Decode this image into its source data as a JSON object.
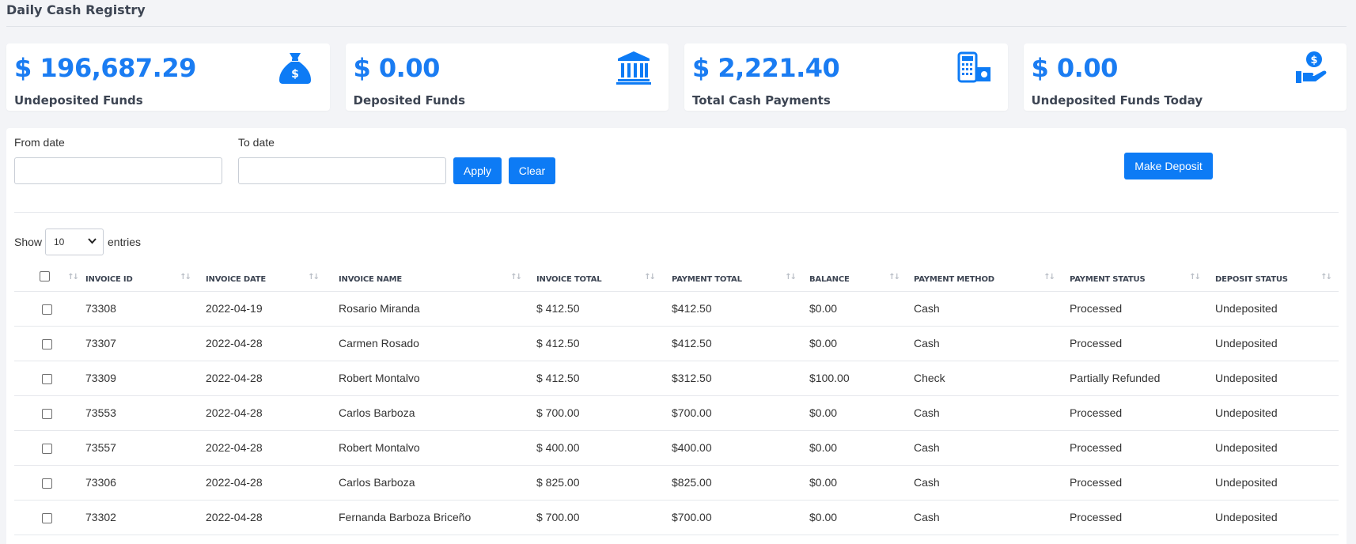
{
  "page": {
    "title": "Daily Cash Registry"
  },
  "colors": {
    "accent": "#1a7cf2",
    "button": "#0d7bf5"
  },
  "cards": [
    {
      "amount": "$ 196,687.29",
      "label": "Undeposited Funds",
      "icon": "money-bag-icon"
    },
    {
      "amount": "$ 0.00",
      "label": "Deposited Funds",
      "icon": "bank-icon"
    },
    {
      "amount": "$ 2,221.40",
      "label": "Total Cash Payments",
      "icon": "calculator-cash-icon"
    },
    {
      "amount": "$ 0.00",
      "label": "Undeposited Funds Today",
      "icon": "hand-coin-icon"
    }
  ],
  "filters": {
    "from_label": "From date",
    "from_value": "",
    "to_label": "To date",
    "to_value": "",
    "apply_label": "Apply",
    "clear_label": "Clear",
    "deposit_label": "Make Deposit"
  },
  "entries": {
    "show_label": "Show",
    "selected": "10",
    "entries_label": "entries"
  },
  "table": {
    "columns": [
      "Invoice ID",
      "Invoice Date",
      "Invoice Name",
      "Invoice Total",
      "Payment Total",
      "Balance",
      "Payment Method",
      "Payment Status",
      "Deposit Status"
    ],
    "rows": [
      [
        "73308",
        "2022-04-19",
        "Rosario Miranda",
        "$ 412.50",
        "$412.50",
        "$0.00",
        "Cash",
        "Processed",
        "Undeposited"
      ],
      [
        "73307",
        "2022-04-28",
        "Carmen Rosado",
        "$ 412.50",
        "$412.50",
        "$0.00",
        "Cash",
        "Processed",
        "Undeposited"
      ],
      [
        "73309",
        "2022-04-28",
        "Robert Montalvo",
        "$ 412.50",
        "$312.50",
        "$100.00",
        "Check",
        "Partially Refunded",
        "Undeposited"
      ],
      [
        "73553",
        "2022-04-28",
        "Carlos Barboza",
        "$ 700.00",
        "$700.00",
        "$0.00",
        "Cash",
        "Processed",
        "Undeposited"
      ],
      [
        "73557",
        "2022-04-28",
        "Robert Montalvo",
        "$ 400.00",
        "$400.00",
        "$0.00",
        "Cash",
        "Processed",
        "Undeposited"
      ],
      [
        "73306",
        "2022-04-28",
        "Carlos Barboza",
        "$ 825.00",
        "$825.00",
        "$0.00",
        "Cash",
        "Processed",
        "Undeposited"
      ],
      [
        "73302",
        "2022-04-28",
        "Fernanda Barboza Briceño",
        "$ 700.00",
        "$700.00",
        "$0.00",
        "Cash",
        "Processed",
        "Undeposited"
      ]
    ]
  }
}
